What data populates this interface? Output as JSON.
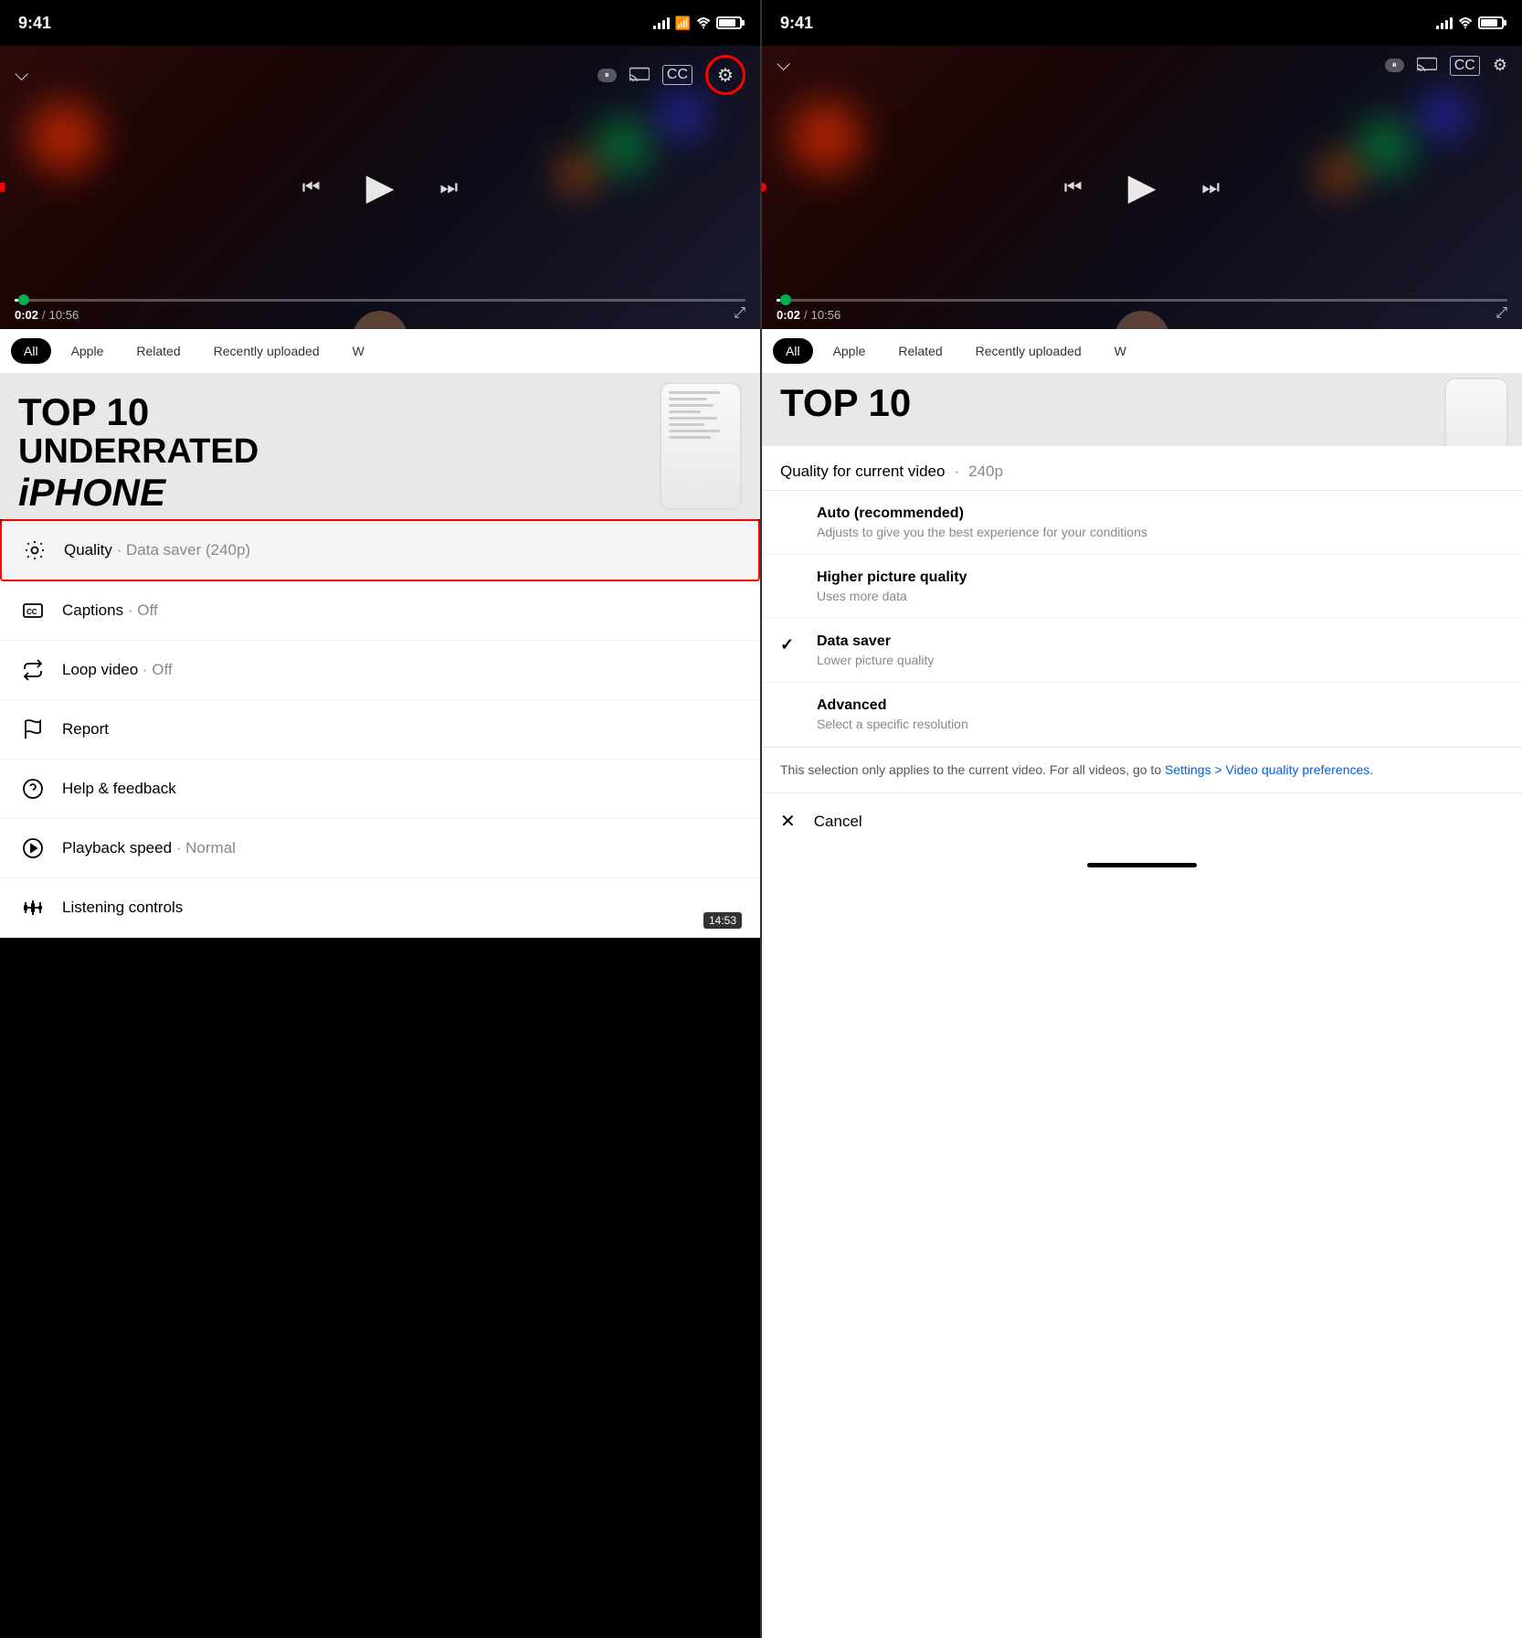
{
  "left_panel": {
    "status_bar": {
      "time": "9:41",
      "signal_full": true,
      "wifi": true,
      "battery": true
    },
    "video": {
      "time_current": "0:02",
      "time_total": "10:56",
      "duration_badge": "14:53"
    },
    "tabs": {
      "items": [
        {
          "label": "All",
          "active": true
        },
        {
          "label": "Apple",
          "active": false
        },
        {
          "label": "Related",
          "active": false
        },
        {
          "label": "Recently uploaded",
          "active": false
        },
        {
          "label": "W",
          "active": false
        }
      ]
    },
    "thumbnail": {
      "text_line1": "TOP 10",
      "text_line2": "UNDERRATED",
      "text_line3": "iPHONE"
    },
    "settings_menu": {
      "items": [
        {
          "id": "quality",
          "icon": "gear-icon",
          "label": "Quality",
          "value": " · Data saver (240p)",
          "highlighted": true
        },
        {
          "id": "captions",
          "icon": "cc-icon",
          "label": "Captions",
          "value": " · Off",
          "highlighted": false
        },
        {
          "id": "loop",
          "icon": "loop-icon",
          "label": "Loop video",
          "value": " · Off",
          "highlighted": false
        },
        {
          "id": "report",
          "icon": "flag-icon",
          "label": "Report",
          "value": "",
          "highlighted": false
        },
        {
          "id": "help",
          "icon": "help-icon",
          "label": "Help & feedback",
          "value": "",
          "highlighted": false
        },
        {
          "id": "playback",
          "icon": "playback-icon",
          "label": "Playback speed",
          "value": " · Normal",
          "highlighted": false
        },
        {
          "id": "listening",
          "icon": "equalizer-icon",
          "label": "Listening controls",
          "value": "",
          "highlighted": false
        }
      ]
    }
  },
  "right_panel": {
    "status_bar": {
      "time": "9:41"
    },
    "quality_sheet": {
      "title": "Quality for current video",
      "dot": "·",
      "current_quality": "240p",
      "options": [
        {
          "id": "auto",
          "title": "Auto (recommended)",
          "description": "Adjusts to give you the best experience for your conditions",
          "selected": false
        },
        {
          "id": "higher",
          "title": "Higher picture quality",
          "description": "Uses more data",
          "selected": false
        },
        {
          "id": "datasaver",
          "title": "Data saver",
          "description": "Lower picture quality",
          "selected": true
        },
        {
          "id": "advanced",
          "title": "Advanced",
          "description": "Select a specific resolution",
          "selected": false
        }
      ],
      "notice": "This selection only applies to the current video. For all videos, go to ",
      "notice_link": "Settings > Video quality preferences.",
      "cancel_label": "Cancel"
    }
  }
}
